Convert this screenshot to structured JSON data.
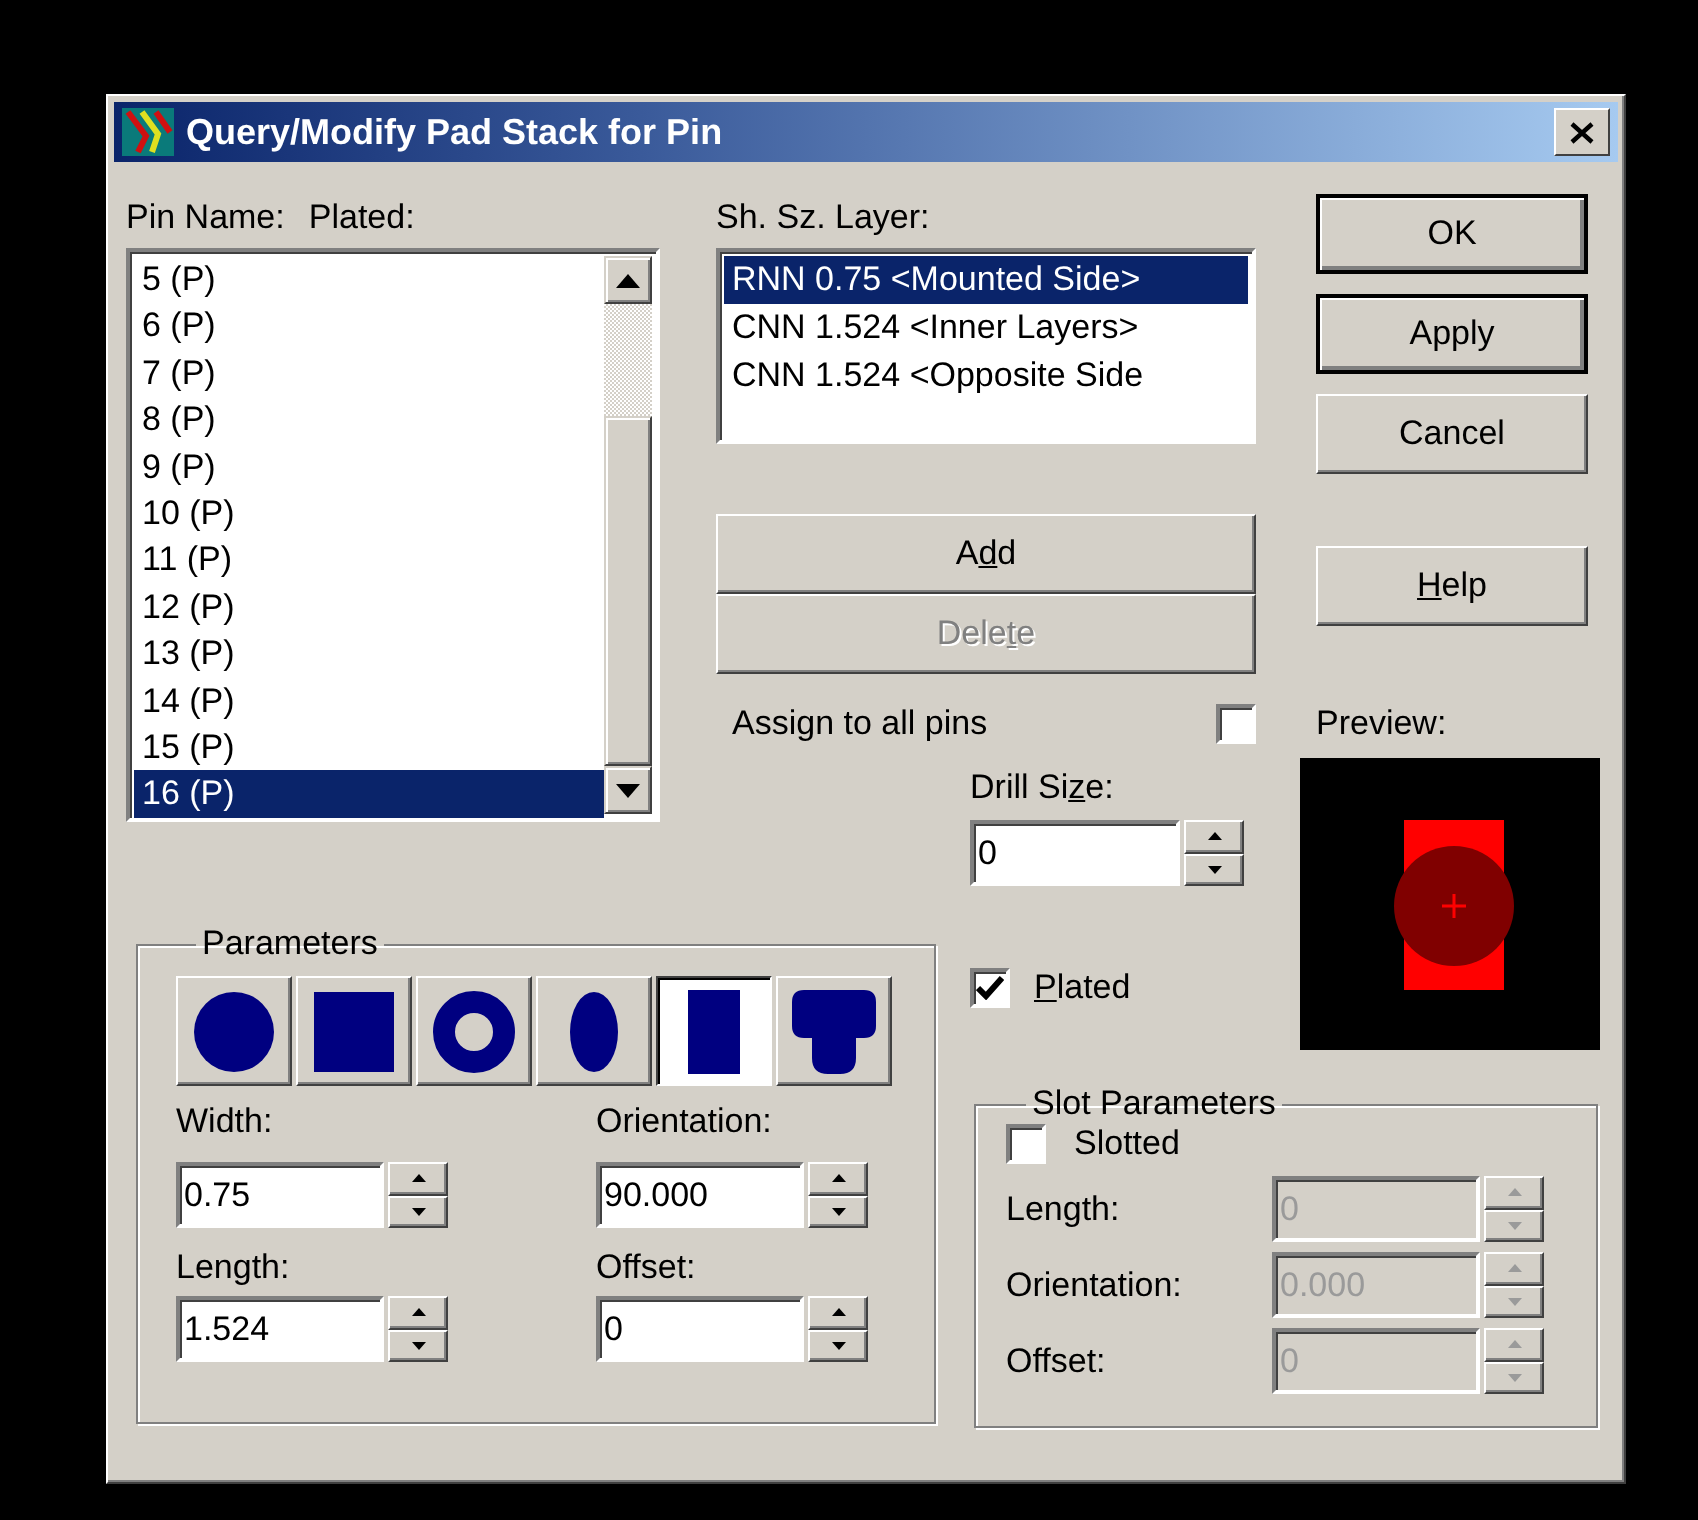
{
  "window": {
    "title": "Query/Modify Pad Stack for Pin"
  },
  "pin_list": {
    "labels": [
      "Pin Name:",
      "Plated:"
    ],
    "items": [
      {
        "label": "5 (P)",
        "selected": false
      },
      {
        "label": "6 (P)",
        "selected": false
      },
      {
        "label": "7 (P)",
        "selected": false
      },
      {
        "label": "8 (P)",
        "selected": false
      },
      {
        "label": "9 (P)",
        "selected": false
      },
      {
        "label": "10 (P)",
        "selected": false
      },
      {
        "label": "11 (P)",
        "selected": false
      },
      {
        "label": "12 (P)",
        "selected": false
      },
      {
        "label": "13 (P)",
        "selected": false
      },
      {
        "label": "14 (P)",
        "selected": false
      },
      {
        "label": "15 (P)",
        "selected": false
      },
      {
        "label": "16 (P)",
        "selected": true
      }
    ]
  },
  "layer_list": {
    "label": "Sh. Sz. Layer:",
    "items": [
      {
        "label": "RNN 0.75 <Mounted Side>",
        "selected": true
      },
      {
        "label": "CNN 1.524 <Inner Layers>",
        "selected": false
      },
      {
        "label": "CNN 1.524 <Opposite Side",
        "selected": false
      }
    ]
  },
  "dialog_buttons": [
    {
      "label": {
        "pre": "OK"
      },
      "focused": true
    },
    {
      "label": {
        "pre": "Apply"
      },
      "focused": true
    },
    {
      "label": {
        "pre": "Cancel"
      },
      "focused": false
    },
    {
      "label": {
        "key": "H",
        "post": "elp"
      },
      "focused": false
    }
  ],
  "layer_buttons": [
    {
      "label": {
        "pre": "A",
        "key": "d",
        "post": "d"
      },
      "disabled": false
    },
    {
      "label": {
        "pre": "Dele",
        "key": "t",
        "post": "e"
      },
      "disabled": true
    }
  ],
  "assign": {
    "label": "Assign to all pins",
    "checked": false
  },
  "preview": {
    "label": "Preview:"
  },
  "drill": {
    "label": {
      "pre": "Drill Si",
      "key": "z",
      "post": "e:"
    },
    "value": "0"
  },
  "plated": {
    "label": {
      "key": "P",
      "post": "lated"
    },
    "checked": true
  },
  "parameters": {
    "title": "Parameters",
    "shapes": [
      {
        "kind": "circle",
        "selected": false
      },
      {
        "kind": "square",
        "selected": false
      },
      {
        "kind": "donut",
        "selected": false
      },
      {
        "kind": "oval",
        "selected": false
      },
      {
        "kind": "rect",
        "selected": true
      },
      {
        "kind": "tee",
        "selected": false
      }
    ],
    "fields": [
      {
        "label": "Width:",
        "value": "0.75"
      },
      {
        "label": "Orientation:",
        "value": "90.000"
      },
      {
        "label": "Length:",
        "value": "1.524"
      },
      {
        "label": "Offset:",
        "value": "0"
      }
    ]
  },
  "slot": {
    "title": "Slot Parameters",
    "slotted": {
      "label": "Slotted",
      "checked": false
    },
    "fields": [
      {
        "label": "Length:",
        "value": "0",
        "disabled": true
      },
      {
        "label": "Orientation:",
        "value": "0.000",
        "disabled": true
      },
      {
        "label": "Offset:",
        "value": "0",
        "disabled": true
      }
    ]
  }
}
